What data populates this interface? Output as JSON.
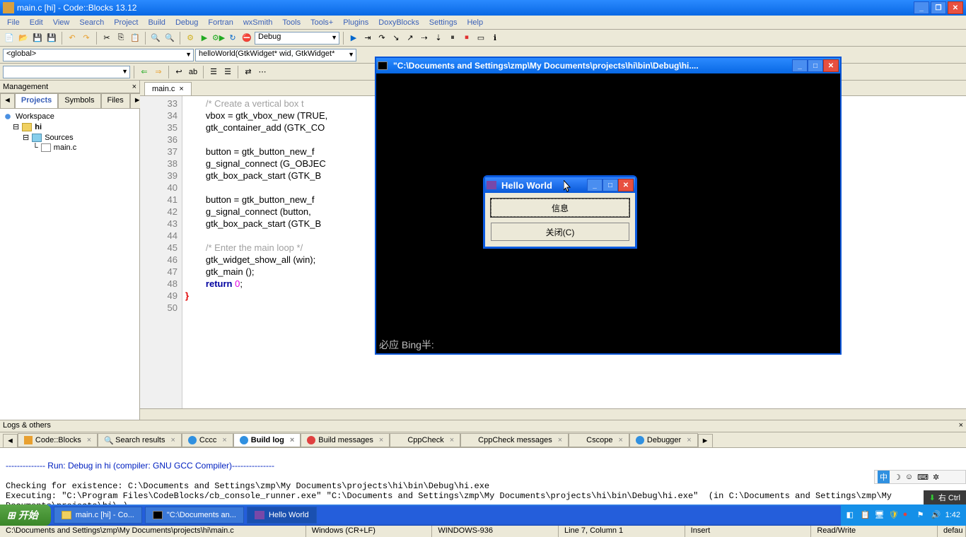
{
  "window": {
    "title": "main.c [hi] - Code::Blocks 13.12"
  },
  "menu": [
    "File",
    "Edit",
    "View",
    "Search",
    "Project",
    "Build",
    "Debug",
    "Fortran",
    "wxSmith",
    "Tools",
    "Tools+",
    "Plugins",
    "DoxyBlocks",
    "Settings",
    "Help"
  ],
  "toolbar2": {
    "scope": "<global>",
    "func": "helloWorld(GtkWidget* wid, GtkWidget*",
    "target": "Debug"
  },
  "mgmt": {
    "title": "Management",
    "tabs": [
      "Projects",
      "Symbols",
      "Files"
    ],
    "tree": {
      "workspace": "Workspace",
      "project": "hi",
      "folder": "Sources",
      "file": "main.c"
    }
  },
  "filetab": "main.c",
  "code": {
    "start": 33,
    "lines": [
      {
        "n": 33,
        "t": "        /* Create a vertical box t",
        "cls": "cm"
      },
      {
        "n": 34,
        "t": "        vbox = gtk_vbox_new (TRUE,"
      },
      {
        "n": 35,
        "t": "        gtk_container_add (GTK_CO"
      },
      {
        "n": 36,
        "t": ""
      },
      {
        "n": 37,
        "t": "        button = gtk_button_new_f"
      },
      {
        "n": 38,
        "t": "        g_signal_connect (G_OBJEC"
      },
      {
        "n": 39,
        "t": "        gtk_box_pack_start (GTK_B"
      },
      {
        "n": 40,
        "t": ""
      },
      {
        "n": 41,
        "t": "        button = gtk_button_new_f"
      },
      {
        "n": 42,
        "t": "        g_signal_connect (button,"
      },
      {
        "n": 43,
        "t": "        gtk_box_pack_start (GTK_B"
      },
      {
        "n": 44,
        "t": ""
      },
      {
        "n": 45,
        "t": "        /* Enter the main loop */",
        "cls": "cm"
      },
      {
        "n": 46,
        "t": "        gtk_widget_show_all (win);"
      },
      {
        "n": 47,
        "t": "        gtk_main ();"
      },
      {
        "n": 48,
        "t": "        return 0;",
        "ret": true
      },
      {
        "n": 49,
        "t": "}",
        "br": true
      },
      {
        "n": 50,
        "t": ""
      }
    ]
  },
  "logs": {
    "title": "Logs & others",
    "tabs": [
      "Code::Blocks",
      "Search results",
      "Cccc",
      "Build log",
      "Build messages",
      "CppCheck",
      "CppCheck messages",
      "Cscope",
      "Debugger"
    ],
    "active": 3,
    "body_header": "-------------- Run: Debug in hi (compiler: GNU GCC Compiler)---------------",
    "body_lines": [
      "Checking for existence: C:\\Documents and Settings\\zmp\\My Documents\\projects\\hi\\bin\\Debug\\hi.exe",
      "Executing: \"C:\\Program Files\\CodeBlocks/cb_console_runner.exe\" \"C:\\Documents and Settings\\zmp\\My Documents\\projects\\hi\\bin\\Debug\\hi.exe\"  (in C:\\Documents and Settings\\zmp\\My Documents\\projects\\hi\\.)"
    ]
  },
  "status": {
    "path": "C:\\Documents and Settings\\zmp\\My Documents\\projects\\hi\\main.c",
    "eol": "Windows (CR+LF)",
    "enc": "WINDOWS-936",
    "pos": "Line 7, Column 1",
    "mode": "Insert",
    "rw": "Read/Write",
    "prof": "defau"
  },
  "console": {
    "title": "\"C:\\Documents and Settings\\zmp\\My Documents\\projects\\hi\\bin\\Debug\\hi....",
    "footer": "必应 Bing半:"
  },
  "hw": {
    "title": "Hello World",
    "btn1": "信息",
    "btn2": "关闭(C)"
  },
  "taskbar": {
    "start": "开始",
    "tasks": [
      {
        "label": "main.c [hi] - Co...",
        "active": false
      },
      {
        "label": "\"C:\\Documents an...",
        "active": false
      },
      {
        "label": "Hello World",
        "active": true
      }
    ],
    "time": "1:42"
  },
  "ime": {
    "label": "中",
    "ctrl": "右 Ctrl"
  }
}
